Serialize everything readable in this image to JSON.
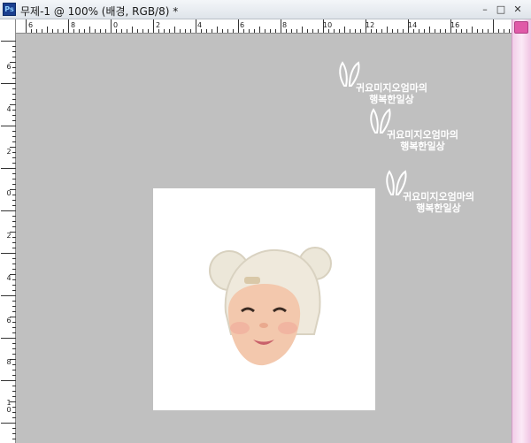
{
  "window": {
    "app_icon_text": "Ps",
    "title": "무제-1 @ 100% (배경, RGB/8) *",
    "minimize_label": "–",
    "maximize_label": "□",
    "close_label": "✕"
  },
  "rulers": {
    "top_labels": [
      "6",
      "8",
      "0",
      "2",
      "4",
      "6",
      "8",
      "10",
      "12",
      "14",
      "16"
    ],
    "left_labels": [
      "6",
      "4",
      "2",
      "0",
      "2",
      "4",
      "6",
      "8",
      "10"
    ]
  },
  "watermarks": [
    {
      "line1": "귀요미지오엄마의",
      "line2": "행복한일상"
    },
    {
      "line1": "귀요미지오엄마의",
      "line2": "행복한일상"
    },
    {
      "line1": "귀요미지오엄마의",
      "line2": "행복한일상"
    }
  ],
  "colors": {
    "workspace": "#c0c0c0",
    "canvas": "#ffffff",
    "scrollbar_accent": "#e05aa8"
  }
}
